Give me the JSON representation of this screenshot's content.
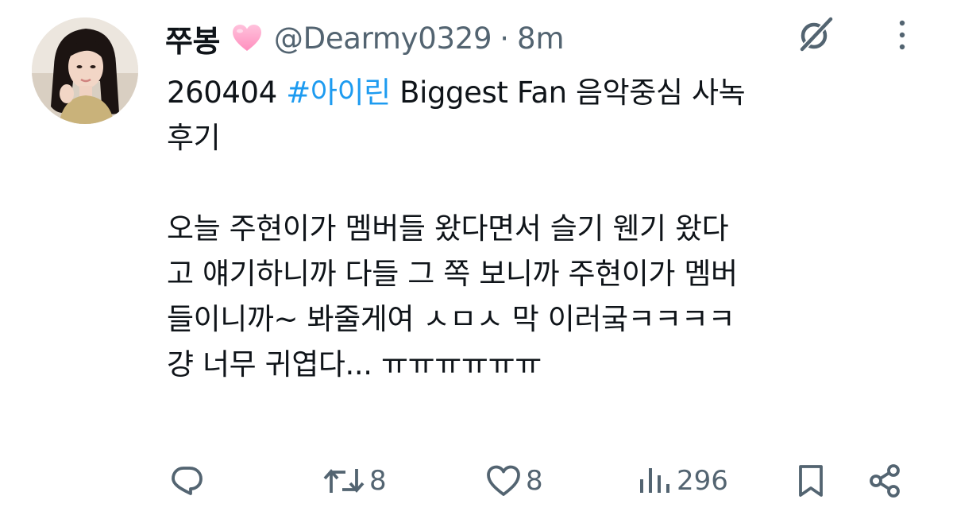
{
  "author": {
    "display_name": "쭈봉",
    "handle": "@Dearmy0329",
    "separator": "·",
    "time": "8m",
    "name_emoji": "pink-heart-icon"
  },
  "tweet": {
    "line1_prefix": "260404 ",
    "hashtag": "#아이린",
    "line1_suffix": " Biggest Fan 음악중심 사녹",
    "line2": "후기",
    "line4": "오늘 주현이가 멤버들 왔다면서 슬기 웬기 왔다",
    "line5": "고 얘기하니까 다들 그 쪽 보니까 주현이가 멤버",
    "line6": "들이니까~ 봐줄게여 ㅅㅁㅅ 막 이러궄ㅋㅋㅋㅋ",
    "line7": "걍 너무 귀엽다... ㅠㅠㅠㅠㅠㅠ"
  },
  "actions": {
    "reply": {
      "icon": "reply-icon",
      "count": ""
    },
    "retweet": {
      "icon": "retweet-icon",
      "count": "8"
    },
    "like": {
      "icon": "heart-icon",
      "count": "8"
    },
    "views": {
      "icon": "views-icon",
      "count": "296"
    },
    "bookmark": {
      "icon": "bookmark-icon",
      "count": ""
    },
    "share": {
      "icon": "share-icon",
      "count": ""
    }
  },
  "colors": {
    "text": "#0f1419",
    "secondary": "#536471",
    "hashtag": "#1d9bf0",
    "heart_emoji": "#ff9ec4"
  }
}
